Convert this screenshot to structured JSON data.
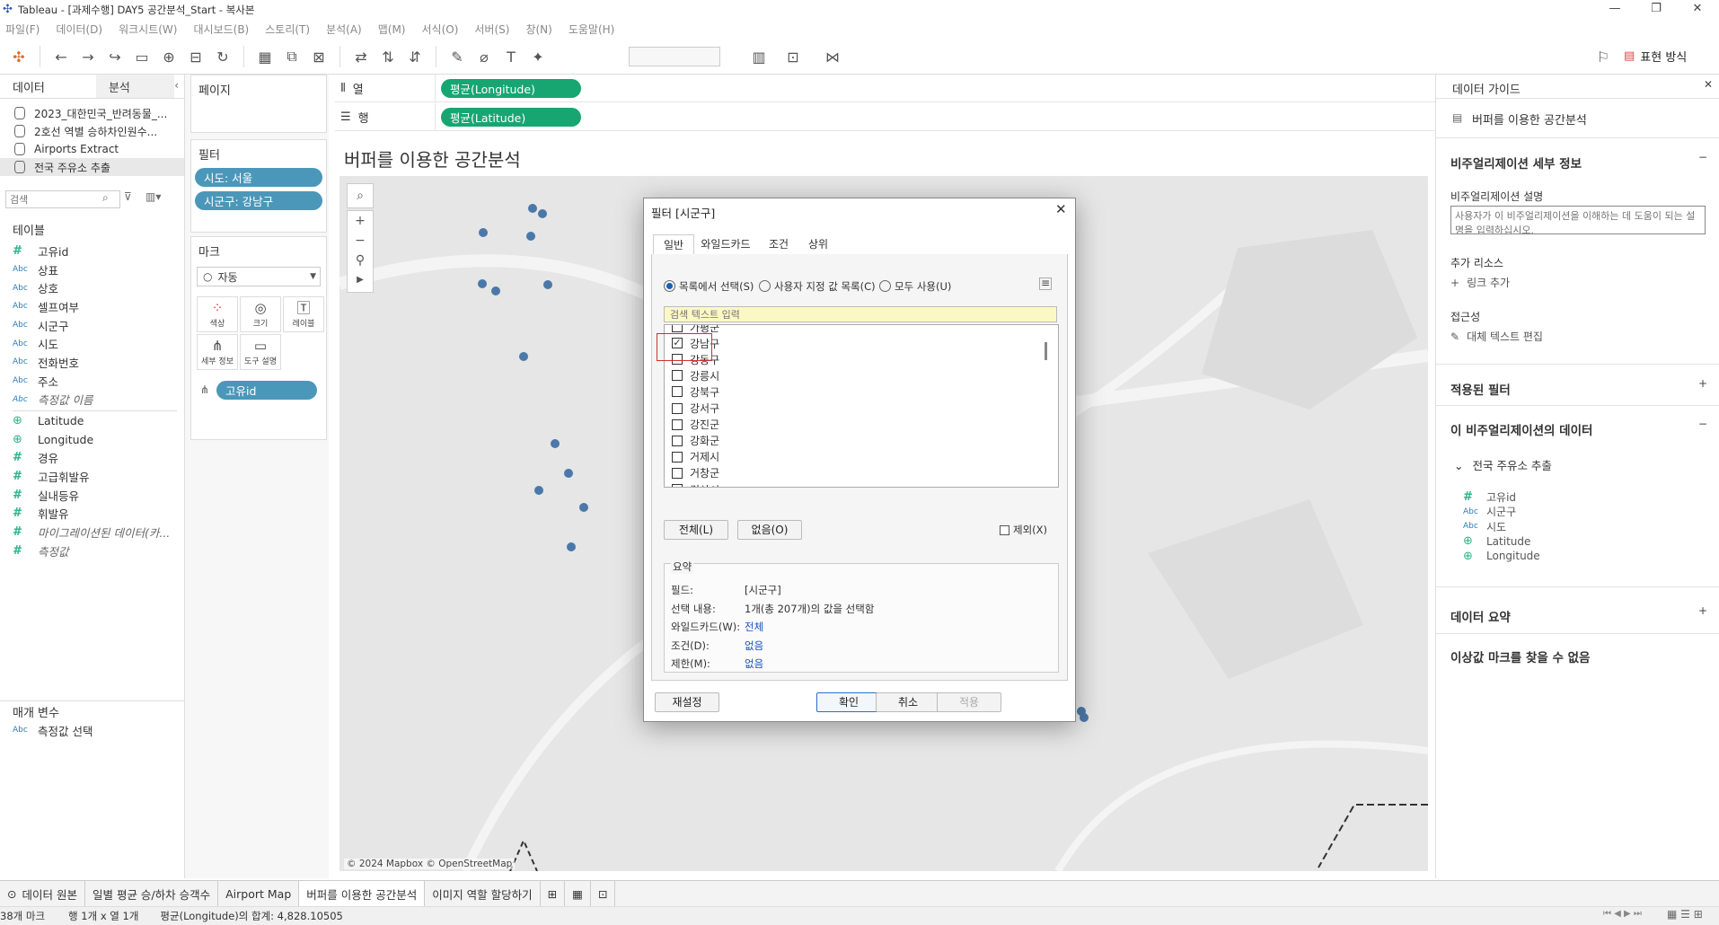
{
  "window": {
    "title": "Tableau - [과제수행] DAY5 공간분석_Start - 복사본"
  },
  "menu": [
    "파일(F)",
    "데이터(D)",
    "워크시트(W)",
    "대시보드(B)",
    "스토리(T)",
    "분석(A)",
    "맵(M)",
    "서식(O)",
    "서버(S)",
    "창(N)",
    "도움말(H)"
  ],
  "toolbar": {
    "show_me": "표현 방식"
  },
  "left": {
    "tab_data": "데이터",
    "tab_analysis": "분석",
    "datasources": [
      "2023_대한민국_반려동물_...",
      "2호선 역별 승하차인원수...",
      "Airports Extract",
      "전국 주유소 추출"
    ],
    "search_placeholder": "검색",
    "tables_title": "테이블",
    "fields": [
      {
        "type": "#",
        "name": "고유id"
      },
      {
        "type": "Abc",
        "name": "상표"
      },
      {
        "type": "Abc",
        "name": "상호"
      },
      {
        "type": "Abc",
        "name": "셀프여부"
      },
      {
        "type": "Abc",
        "name": "시군구"
      },
      {
        "type": "Abc",
        "name": "시도"
      },
      {
        "type": "Abc",
        "name": "전화번호"
      },
      {
        "type": "Abc",
        "name": "주소"
      },
      {
        "type": "Abc",
        "name": "측정값 이름"
      },
      {
        "type": "globe",
        "name": "Latitude"
      },
      {
        "type": "globe",
        "name": "Longitude"
      },
      {
        "type": "#",
        "name": "경유"
      },
      {
        "type": "#",
        "name": "고급휘발유"
      },
      {
        "type": "#",
        "name": "실내등유"
      },
      {
        "type": "#",
        "name": "휘발유"
      },
      {
        "type": "#",
        "name": "마이그레이션된 데이터(카..."
      },
      {
        "type": "#",
        "name": "측정값"
      }
    ],
    "params_title": "매개 변수",
    "param": {
      "type": "Abc",
      "name": "측정값 선택"
    }
  },
  "shelves": {
    "pages": "페이지",
    "filters_title": "필터",
    "filters": [
      "시도: 서울",
      "시군구: 강남구"
    ],
    "marks_title": "마크",
    "mark_type": "자동",
    "mark_buttons": [
      "색상",
      "크기",
      "레이블",
      "세부 정보",
      "도구 설명"
    ],
    "mark_field": "고유id",
    "columns_label": "열",
    "rows_label": "행",
    "columns_pill": "평균(Longitude)",
    "rows_pill": "평균(Latitude)"
  },
  "viz": {
    "title": "버퍼를 이용한 공간분석",
    "attribution": "© 2024 Mapbox © OpenStreetMap"
  },
  "dialog": {
    "title": "필터 [시군구]",
    "tabs": [
      "일반",
      "와일드카드",
      "조건",
      "상위"
    ],
    "radio_list": "목록에서 선택(S)",
    "radio_custom": "사용자 지정 값 목록(C)",
    "radio_all": "모두 사용(U)",
    "search_placeholder": "검색 텍스트 입력",
    "items": [
      {
        "label": "가평군",
        "checked": false
      },
      {
        "label": "강남구",
        "checked": true
      },
      {
        "label": "강동구",
        "checked": false
      },
      {
        "label": "강릉시",
        "checked": false
      },
      {
        "label": "강북구",
        "checked": false
      },
      {
        "label": "강서구",
        "checked": false
      },
      {
        "label": "강진군",
        "checked": false
      },
      {
        "label": "강화군",
        "checked": false
      },
      {
        "label": "거제시",
        "checked": false
      },
      {
        "label": "거창군",
        "checked": false
      },
      {
        "label": "경산시",
        "checked": false
      }
    ],
    "btn_all": "전체(L)",
    "btn_none": "없음(O)",
    "exclude": "제외(X)",
    "summary_title": "요약",
    "summary": [
      {
        "k": "필드:",
        "v": "[시군구]",
        "link": false
      },
      {
        "k": "선택 내용:",
        "v": "1개(총 207개)의 값을 선택함",
        "link": false
      },
      {
        "k": "와일드카드(W):",
        "v": "전체",
        "link": true
      },
      {
        "k": "조건(D):",
        "v": "없음",
        "link": true
      },
      {
        "k": "제한(M):",
        "v": "없음",
        "link": true
      }
    ],
    "btn_reset": "재설정",
    "btn_ok": "확인",
    "btn_cancel": "취소",
    "btn_apply": "적용"
  },
  "guide": {
    "title": "데이터 가이드",
    "sheet": "버퍼를 이용한 공간분석",
    "viz_details": "비주얼리제이션 세부 정보",
    "desc_label": "비주얼리제이션 설명",
    "desc_placeholder": "사용자가 이 비주얼리제이션을 이해하는 데 도움이 되는 설명을 입력하십시오.",
    "resources": "추가 리소스",
    "add_link": "링크 추가",
    "access": "접근성",
    "alt_text": "대체 텍스트 편집",
    "applied_filters": "적용된 필터",
    "data_in_viz": "이 비주얼리제이션의 데이터",
    "ds_name": "전국 주유소 추출",
    "ds_fields": [
      {
        "type": "#",
        "name": "고유id"
      },
      {
        "type": "Abc",
        "name": "시군구"
      },
      {
        "type": "Abc",
        "name": "시도"
      },
      {
        "type": "globe",
        "name": "Latitude"
      },
      {
        "type": "globe",
        "name": "Longitude"
      }
    ],
    "data_summary": "데이터 요약",
    "no_outliers": "이상값 마크를 찾을 수 없음"
  },
  "bottom_tabs": [
    "데이터 원본",
    "일별 평균 승/하차 승객수",
    "Airport Map",
    "버퍼를 이용한 공간분석",
    "이미지 역할 할당하기"
  ],
  "status": {
    "marks": "38개 마크",
    "rows_cols": "행 1개 x 열 1개",
    "sum": "평균(Longitude)의 합계: 4,828.10505"
  },
  "colors": {
    "pill_blue": "#4b97b9",
    "pill_green": "#17a672",
    "dot": "#4a78a8",
    "highlight_box": "#d32f2f"
  }
}
